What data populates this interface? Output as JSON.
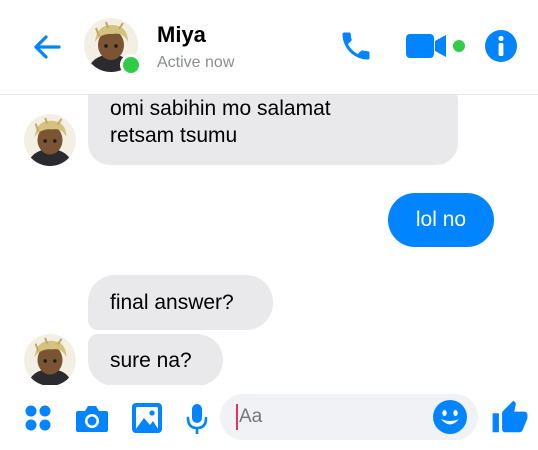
{
  "header": {
    "contact_name": "Miya",
    "contact_status": "Active now",
    "accent_color": "#0084ff",
    "online_color": "#31cc46",
    "icons": [
      "back-arrow-icon",
      "phone-icon",
      "video-camera-icon",
      "info-icon"
    ]
  },
  "messages": [
    {
      "sender": "Miya",
      "direction": "incoming",
      "lines": [
        "omi sabihin mo salamat",
        "retsam tsumu"
      ]
    },
    {
      "sender": "me",
      "direction": "outgoing",
      "lines": [
        "lol no"
      ]
    },
    {
      "sender": "Miya",
      "direction": "incoming",
      "lines": [
        "final answer?"
      ]
    },
    {
      "sender": "Miya",
      "direction": "incoming",
      "lines": [
        "sure na?"
      ]
    }
  ],
  "composer": {
    "placeholder": "Aa",
    "icons": [
      "apps-grid-icon",
      "camera-icon",
      "image-gallery-icon",
      "microphone-icon",
      "emoji-icon",
      "thumbs-up-icon"
    ]
  },
  "colors": {
    "incoming_bubble": "#e9e9eb",
    "outgoing_bubble": "#0084ff",
    "input_background": "#f0f2f5"
  }
}
